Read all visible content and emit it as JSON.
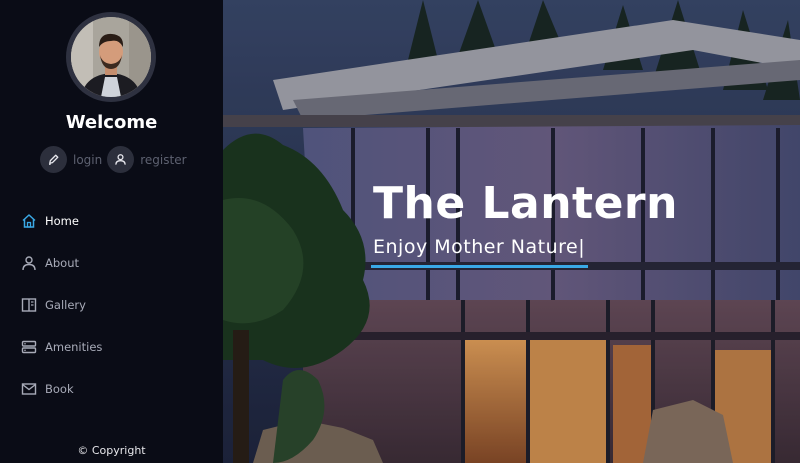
{
  "sidebar": {
    "welcome": "Welcome",
    "login_label": "login",
    "register_label": "register",
    "nav_items": [
      {
        "label": "Home",
        "icon": "home-icon",
        "active": true
      },
      {
        "label": "About",
        "icon": "user-icon",
        "active": false
      },
      {
        "label": "Gallery",
        "icon": "gallery-icon",
        "active": false
      },
      {
        "label": "Amenities",
        "icon": "server-icon",
        "active": false
      },
      {
        "label": "Book",
        "icon": "mail-icon",
        "active": false
      }
    ],
    "copyright": "© Copyright",
    "accent_color": "#3aa9e6"
  },
  "hero": {
    "title": "The Lantern",
    "subtitle": "Enjoy Mother Nature|"
  }
}
